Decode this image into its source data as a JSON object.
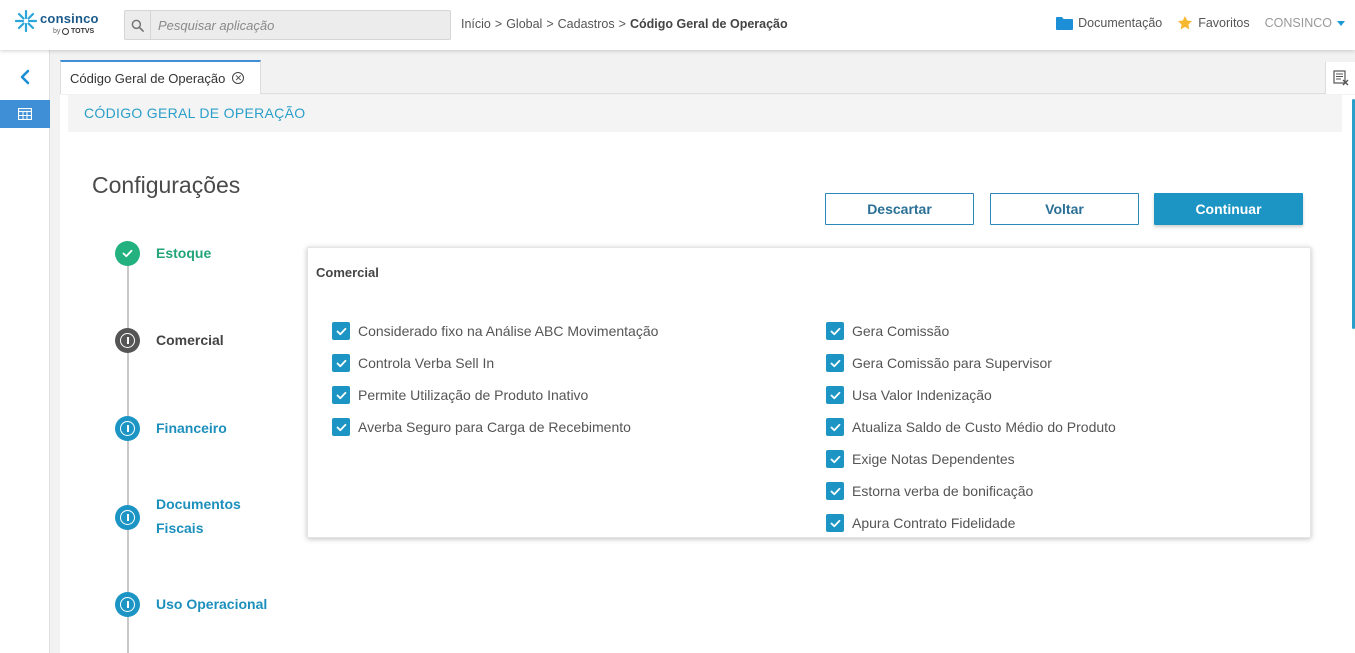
{
  "brand": {
    "name": "consinco",
    "by": "by",
    "vendor": "TOTVS"
  },
  "search": {
    "placeholder": "Pesquisar aplicação",
    "value": ""
  },
  "breadcrumb": [
    "Início",
    "Global",
    "Cadastros",
    "Código Geral de Operação"
  ],
  "breadcrumb_sep": ">",
  "header_links": {
    "docs": "Documentação",
    "favorites": "Favoritos",
    "user": "CONSINCO"
  },
  "tabs": [
    {
      "label": "Código Geral de Operação",
      "active": true
    }
  ],
  "page": {
    "header_title": "CÓDIGO GERAL DE OPERAÇÃO",
    "section_title": "Configurações"
  },
  "buttons": {
    "discard": "Descartar",
    "back": "Voltar",
    "continue": "Continuar"
  },
  "steps": [
    {
      "label": "Estoque",
      "state": "done"
    },
    {
      "label": "Comercial",
      "state": "current"
    },
    {
      "label": "Financeiro",
      "state": "info"
    },
    {
      "label": "Documentos Fiscais",
      "line1": "Documentos",
      "line2": "Fiscais",
      "state": "info"
    },
    {
      "label": "Uso Operacional",
      "state": "info"
    }
  ],
  "panel": {
    "title": "Comercial",
    "left": [
      {
        "label": "Considerado fixo na Análise ABC Movimentação",
        "checked": true
      },
      {
        "label": "Controla Verba Sell In",
        "checked": true
      },
      {
        "label": "Permite Utilização de Produto Inativo",
        "checked": true
      },
      {
        "label": "Averba Seguro para Carga de Recebimento",
        "checked": true
      }
    ],
    "right": [
      {
        "label": "Gera Comissão",
        "checked": true
      },
      {
        "label": "Gera Comissão para Supervisor",
        "checked": true
      },
      {
        "label": "Usa Valor Indenização",
        "checked": true
      },
      {
        "label": "Atualiza Saldo de Custo Médio do Produto",
        "checked": true
      },
      {
        "label": "Exige Notas Dependentes",
        "checked": true
      },
      {
        "label": "Estorna verba de bonificação",
        "checked": true
      },
      {
        "label": "Apura Contrato Fidelidade",
        "checked": true
      }
    ]
  },
  "colors": {
    "accent": "#1c95c4",
    "done": "#23b17f",
    "current": "#555555",
    "rail_active": "#3f8fd6"
  }
}
